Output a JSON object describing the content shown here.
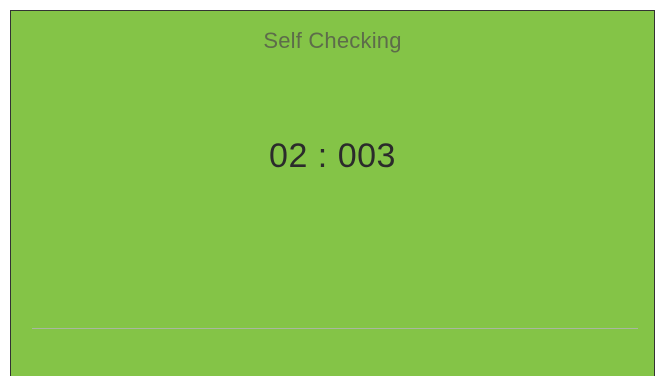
{
  "screen": {
    "title": "Self Checking",
    "timer": "02 : 003"
  },
  "colors": {
    "panel_background": "#84c447",
    "title_text": "#5d6c4a",
    "timer_text": "#2b2b2b",
    "divider": "#a9b7a0",
    "border": "#333333"
  }
}
